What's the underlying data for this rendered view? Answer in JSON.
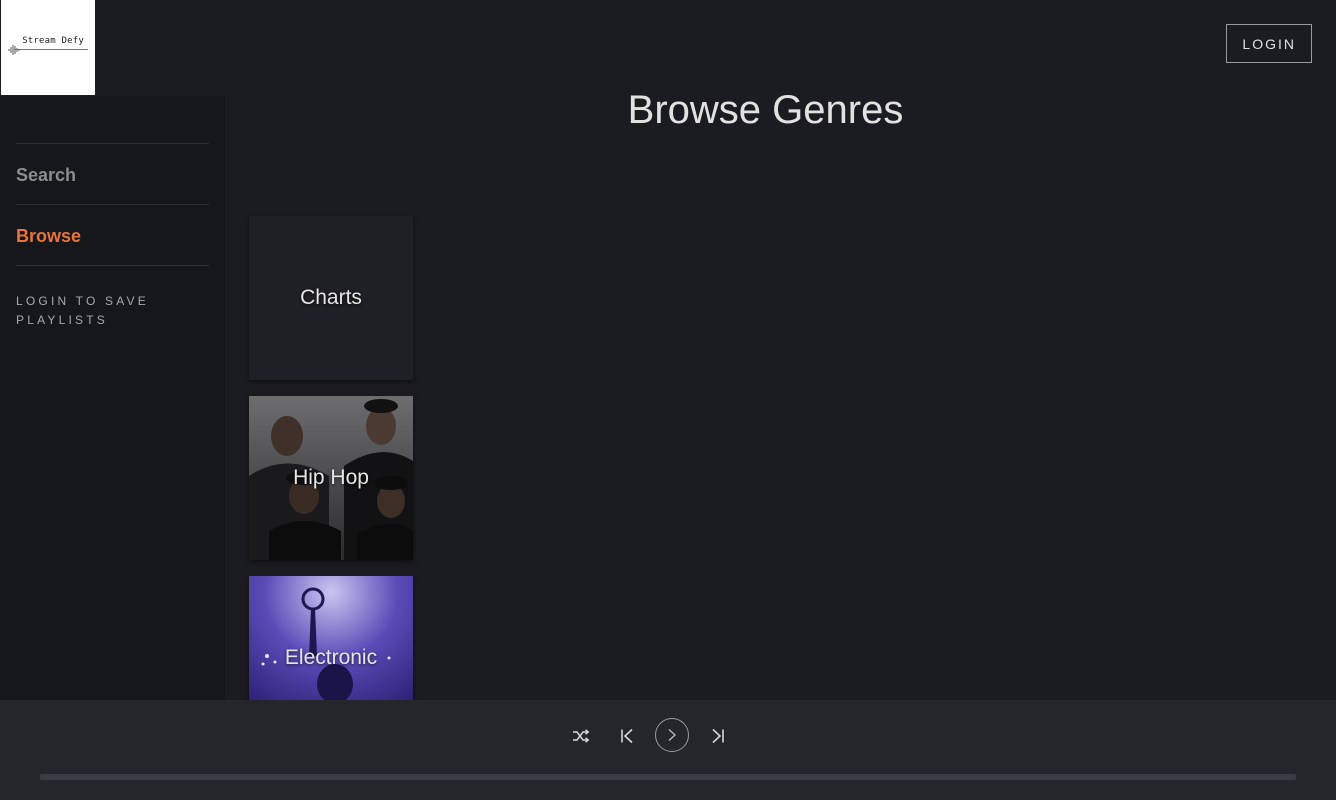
{
  "brand": {
    "logo_text": "Stream Defy"
  },
  "header": {
    "login_label": "LOGIN"
  },
  "sidebar": {
    "items": [
      {
        "label": "Search",
        "active": false
      },
      {
        "label": "Browse",
        "active": true
      }
    ],
    "login_prompt": "LOGIN TO SAVE PLAYLISTS"
  },
  "main": {
    "title": "Browse Genres",
    "genres": [
      {
        "label": "Charts"
      },
      {
        "label": "Hip Hop"
      },
      {
        "label": "Electronic"
      }
    ]
  },
  "player": {
    "controls": [
      "shuffle-icon",
      "previous-icon",
      "play-icon",
      "next-icon"
    ],
    "progress": 0
  },
  "colors": {
    "accent": "#e8743b",
    "background": "#1b1c21",
    "sidebar": "#16171b",
    "player_bar": "#24262c"
  }
}
